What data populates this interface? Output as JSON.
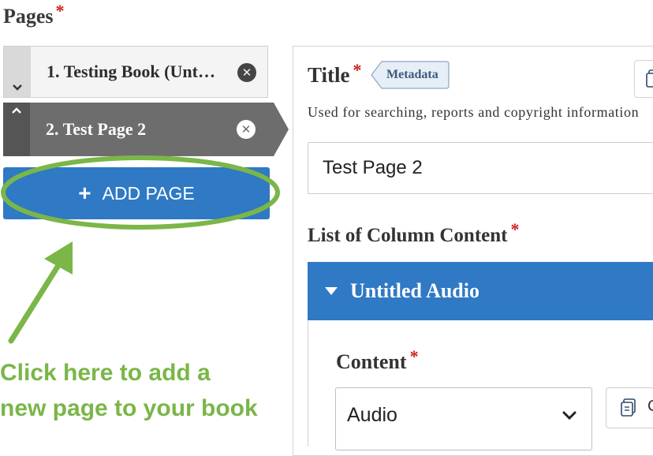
{
  "pages_section": {
    "heading": "Pages",
    "required_mark": "*",
    "items": [
      {
        "label": "1. Testing Book (Unt…",
        "toggle_icon": "chevron-down",
        "remove_icon": "x-circle",
        "state": "collapsed"
      },
      {
        "label": "2. Test Page 2",
        "toggle_icon": "chevron-up",
        "remove_icon": "x-circle",
        "state": "selected"
      }
    ],
    "add_button": {
      "icon": "+",
      "label": "ADD PAGE"
    }
  },
  "annotation": {
    "line1": "Click here to add a",
    "line2": "new page to your book",
    "color": "#7ab648"
  },
  "form": {
    "title": {
      "label": "Title",
      "required_mark": "*",
      "tag": "Metadata",
      "help": "Used for searching, reports and copyright information",
      "value": "Test Page 2"
    },
    "column_content": {
      "label": "List of Column Content",
      "required_mark": "*",
      "item": {
        "title": "Untitled Audio",
        "content_label": "Content",
        "required_mark": "*",
        "selected": "Audio",
        "copy_label": "C"
      }
    }
  },
  "colors": {
    "primary_blue": "#2f79c5",
    "selected_gray": "#6d6d6d",
    "required_red": "#d0201d"
  }
}
